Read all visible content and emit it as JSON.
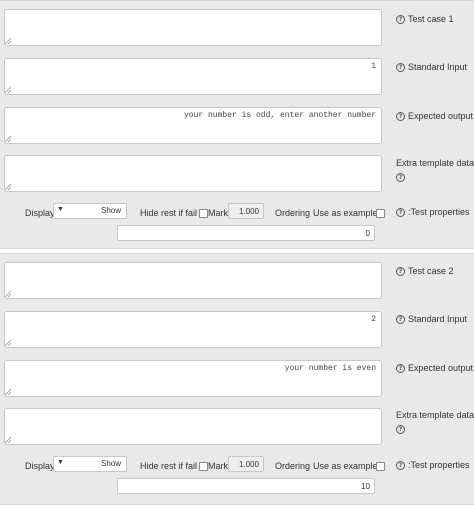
{
  "testcases": [
    {
      "title": "Test case 1",
      "testcode": "",
      "stdin": "1",
      "expected": "your number is odd, enter another number",
      "extra": "",
      "labels": {
        "stdin": "Standard Input",
        "expected": "Expected output",
        "extra": "Extra template data"
      },
      "display_label": "Display",
      "display_value": "Show",
      "display_arrow": "▼",
      "hiderest_label": "Hide rest if fail",
      "mark_label": "Mark",
      "mark_value": "1.000",
      "ordering_label": "Ordering",
      "useasexample_label": "Use as example",
      "properties_label": ":Test properties",
      "ordering_value": "0"
    },
    {
      "title": "Test case 2",
      "testcode": "",
      "stdin": "2",
      "expected": "your number is even",
      "extra": "",
      "labels": {
        "stdin": "Standard Input",
        "expected": "Expected output",
        "extra": "Extra template data"
      },
      "display_label": "Display",
      "display_value": "Show",
      "display_arrow": "▼",
      "hiderest_label": "Hide rest if fail",
      "mark_label": "Mark",
      "mark_value": "1.000",
      "ordering_label": "Ordering",
      "useasexample_label": "Use as example",
      "properties_label": ":Test properties",
      "ordering_value": "10"
    }
  ],
  "icons": {
    "help": "?",
    "help_icon_name": "question-circle-icon",
    "resize_icon_name": "resize-grip-icon"
  },
  "colors": {
    "panel_bg": "#e9e9e9",
    "field_border": "#c7c7c7"
  }
}
